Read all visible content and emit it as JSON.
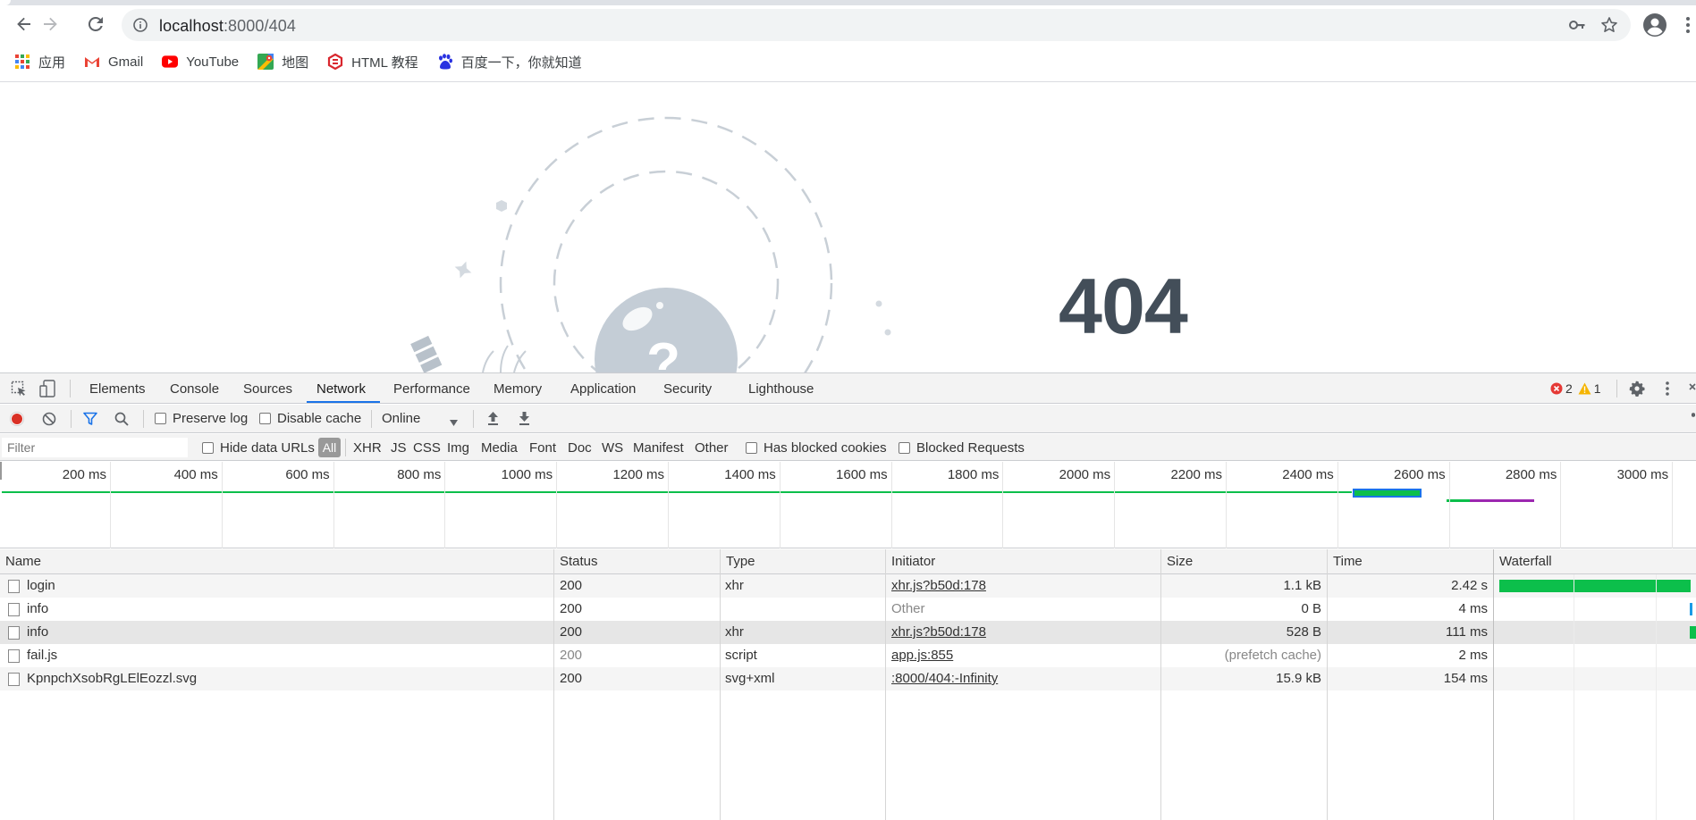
{
  "browser": {
    "url_host": "localhost",
    "url_path": ":8000/404",
    "bookmarks": [
      {
        "label": "应用",
        "icon": "apps-grid-icon"
      },
      {
        "label": "Gmail",
        "icon": "gmail-icon"
      },
      {
        "label": "YouTube",
        "icon": "youtube-icon"
      },
      {
        "label": "地图",
        "icon": "maps-icon"
      },
      {
        "label": "HTML 教程",
        "icon": "runoob-icon"
      },
      {
        "label": "百度一下，你就知道",
        "icon": "baidu-icon"
      }
    ]
  },
  "page": {
    "code": "404",
    "illustration_glyph": "?"
  },
  "devtools": {
    "tabs": [
      "Elements",
      "Console",
      "Sources",
      "Network",
      "Performance",
      "Memory",
      "Application",
      "Security",
      "Lighthouse"
    ],
    "active_tab": "Network",
    "errors": "2",
    "warnings": "1",
    "toolbar": {
      "preserve_log": "Preserve log",
      "disable_cache": "Disable cache",
      "throttling": "Online"
    },
    "filter": {
      "placeholder": "Filter",
      "hide_data_urls": "Hide data URLs",
      "all": "All",
      "types": [
        "XHR",
        "JS",
        "CSS",
        "Img",
        "Media",
        "Font",
        "Doc",
        "WS",
        "Manifest",
        "Other"
      ],
      "has_blocked_cookies": "Has blocked cookies",
      "blocked_requests": "Blocked Requests"
    },
    "overview_ticks": [
      "200 ms",
      "400 ms",
      "600 ms",
      "800 ms",
      "1000 ms",
      "1200 ms",
      "1400 ms",
      "1600 ms",
      "1800 ms",
      "2000 ms",
      "2200 ms",
      "2400 ms",
      "2600 ms",
      "2800 ms",
      "3000 ms"
    ],
    "columns": {
      "name": "Name",
      "status": "Status",
      "type": "Type",
      "initiator": "Initiator",
      "size": "Size",
      "time": "Time",
      "waterfall": "Waterfall"
    },
    "rows": [
      {
        "name": "login",
        "status": "200",
        "type": "xhr",
        "initiator": "xhr.js?b50d:178",
        "size": "1.1 kB",
        "time": "2.42 s"
      },
      {
        "name": "info",
        "status": "200",
        "type": "",
        "initiator": "Other",
        "size": "0 B",
        "time": "4 ms"
      },
      {
        "name": "info",
        "status": "200",
        "type": "xhr",
        "initiator": "xhr.js?b50d:178",
        "size": "528 B",
        "time": "111 ms"
      },
      {
        "name": "fail.js",
        "status": "200",
        "type": "script",
        "initiator": "app.js:855",
        "size": "(prefetch cache)",
        "time": "2 ms"
      },
      {
        "name": "KpnpchXsobRgLElEozzl.svg",
        "status": "200",
        "type": "svg+xml",
        "initiator": ":8000/404:-Infinity",
        "size": "15.9 kB",
        "time": "154 ms"
      }
    ],
    "colors": {
      "accent": "#1a73e8",
      "record": "#d93025",
      "waterfall_green": "#0cbf4b",
      "waterfall_blue": "#1a9be6",
      "error_red": "#e53935",
      "warning_yellow": "#f5b400"
    }
  }
}
